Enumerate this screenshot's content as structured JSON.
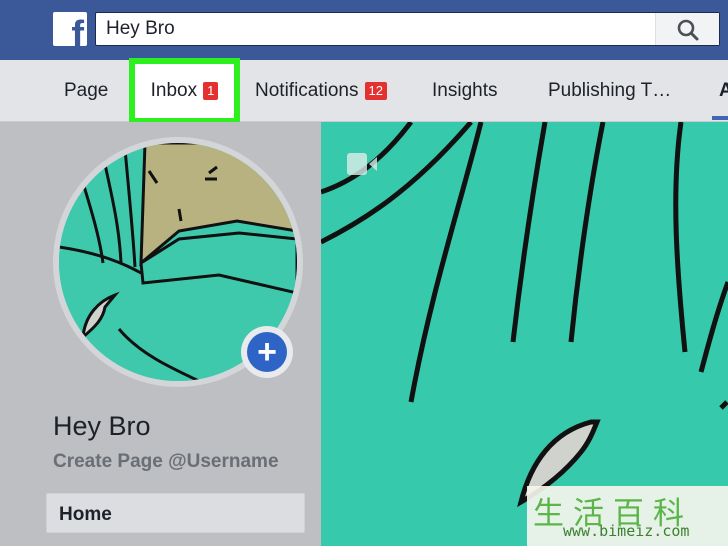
{
  "header": {
    "logo_letter": "f",
    "search": {
      "value": "Hey Bro"
    }
  },
  "tabs": [
    {
      "label": "Page"
    },
    {
      "label": "Inbox",
      "badge": "1"
    },
    {
      "label": "Notifications",
      "badge": "12"
    },
    {
      "label": "Insights"
    },
    {
      "label": "Publishing T…"
    },
    {
      "label": "A"
    }
  ],
  "highlight_color": "#2ef021",
  "profile": {
    "name": "Hey Bro",
    "username_link": "Create Page @Username",
    "add_photo_symbol": "+"
  },
  "sidebar": {
    "items": [
      {
        "label": "Home"
      }
    ]
  },
  "icons": [
    "facebook-logo-icon",
    "search-icon",
    "plus-icon",
    "video-camera-icon"
  ],
  "watermark": {
    "chars": "生活百科",
    "url": "www.bimeiz.com"
  }
}
